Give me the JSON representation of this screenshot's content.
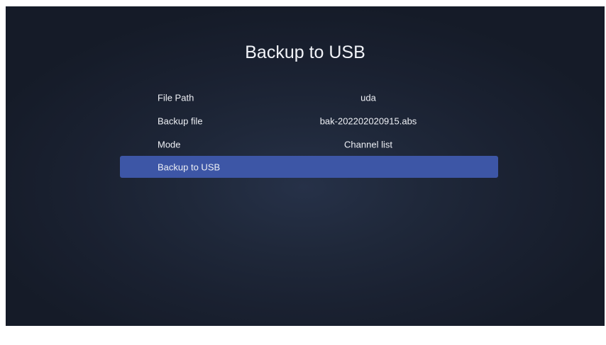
{
  "page": {
    "title": "Backup to USB"
  },
  "menu": {
    "items": [
      {
        "label": "File Path",
        "value": "uda"
      },
      {
        "label": "Backup file",
        "value": "bak-202202020915.abs"
      },
      {
        "label": "Mode",
        "value": "Channel list"
      },
      {
        "label": "Backup to USB",
        "value": ""
      }
    ],
    "selected_index": 3
  },
  "colors": {
    "background": "#1c2333",
    "selection": "#3d56a6",
    "text": "#eef0f5"
  }
}
